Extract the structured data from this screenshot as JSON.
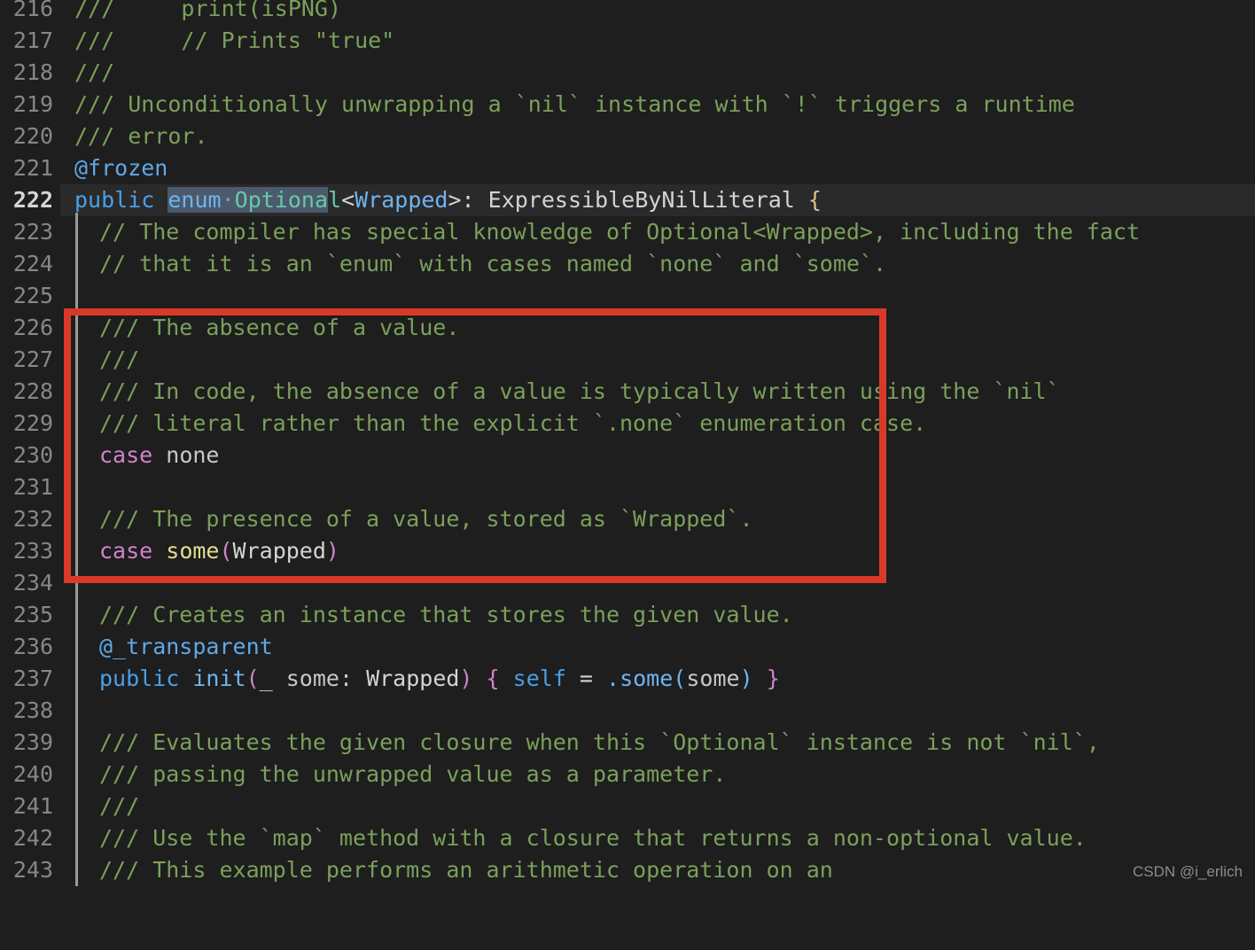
{
  "editor": {
    "background": "#1e1e1e",
    "font_size_px": 25,
    "line_height_px": 36,
    "first_line_number": 216,
    "current_line_number": 222,
    "selection_color": "#4c5a6b",
    "annotation_color": "#d93a27"
  },
  "gutter": {
    "line_numbers": [
      "216",
      "217",
      "218",
      "219",
      "220",
      "221",
      "222",
      "223",
      "224",
      "225",
      "226",
      "227",
      "228",
      "229",
      "230",
      "231",
      "232",
      "233",
      "234",
      "235",
      "236",
      "237",
      "238",
      "239",
      "240",
      "241",
      "242",
      "243"
    ]
  },
  "lines": [
    {
      "n": "216",
      "text": "///     print(isPNG)"
    },
    {
      "n": "217",
      "text": "///     // Prints \"true\""
    },
    {
      "n": "218",
      "text": "///"
    },
    {
      "n": "219",
      "text": "/// Unconditionally unwrapping a `nil` instance with `!` triggers a runtime"
    },
    {
      "n": "220",
      "text": "/// error."
    },
    {
      "n": "221",
      "text": "@frozen"
    },
    {
      "n": "222",
      "text": "public enum Optional<Wrapped>: ExpressibleByNilLiteral {"
    },
    {
      "n": "223",
      "text": "  // The compiler has special knowledge of Optional<Wrapped>, including the fact"
    },
    {
      "n": "224",
      "text": "  // that it is an `enum` with cases named `none` and `some`."
    },
    {
      "n": "225",
      "text": ""
    },
    {
      "n": "226",
      "text": "  /// The absence of a value."
    },
    {
      "n": "227",
      "text": "  ///"
    },
    {
      "n": "228",
      "text": "  /// In code, the absence of a value is typically written using the `nil`"
    },
    {
      "n": "229",
      "text": "  /// literal rather than the explicit `.none` enumeration case."
    },
    {
      "n": "230",
      "text": "  case none"
    },
    {
      "n": "231",
      "text": ""
    },
    {
      "n": "232",
      "text": "  /// The presence of a value, stored as `Wrapped`."
    },
    {
      "n": "233",
      "text": "  case some(Wrapped)"
    },
    {
      "n": "234",
      "text": ""
    },
    {
      "n": "235",
      "text": "  /// Creates an instance that stores the given value."
    },
    {
      "n": "236",
      "text": "  @_transparent"
    },
    {
      "n": "237",
      "text": "  public init(_ some: Wrapped) { self = .some(some) }"
    },
    {
      "n": "238",
      "text": ""
    },
    {
      "n": "239",
      "text": "  /// Evaluates the given closure when this `Optional` instance is not `nil`,"
    },
    {
      "n": "240",
      "text": "  /// passing the unwrapped value as a parameter."
    },
    {
      "n": "241",
      "text": "  ///"
    },
    {
      "n": "242",
      "text": "  /// Use the `map` method with a closure that returns a non-optional value."
    },
    {
      "n": "243",
      "text": "  /// This example performs an arithmetic operation on an"
    }
  ],
  "tokens": {
    "l216_doc": "///     print(isPNG)",
    "l217_doc": "///     // Prints \"true\"",
    "l218_doc": "///",
    "l219_doc": "/// Unconditionally unwrapping a `nil` instance with `!` triggers a runtime",
    "l220_doc": "/// error.",
    "l221_attr": "@frozen",
    "l222_public": "public ",
    "l222_sel_enum": "enum",
    "l222_sel_dot": "·",
    "l222_sel_optiona": "Optiona",
    "l222_l": "l",
    "l222_lt": "<",
    "l222_wrapped": "Wrapped",
    "l222_gt": ">",
    "l222_conform": ": ExpressibleByNilLiteral ",
    "l222_brace": "{",
    "l223_cmt": "// The compiler has special knowledge of Optional<Wrapped>, including the fact",
    "l224_cmt": "// that it is an `enum` with cases named `none` and `some`.",
    "l226_doc": "/// The absence of a value.",
    "l227_doc": "///",
    "l228_doc": "/// In code, the absence of a value is typically written using the `nil`",
    "l229_doc": "/// literal rather than the explicit `.none` enumeration case.",
    "l230_case": "case ",
    "l230_none": "none",
    "l232_doc": "/// The presence of a value, stored as `Wrapped`.",
    "l233_case": "case ",
    "l233_some": "some",
    "l233_lparen": "(",
    "l233_wrapped": "Wrapped",
    "l233_rparen": ")",
    "l235_doc": "/// Creates an instance that stores the given value.",
    "l236_attr": "@_transparent",
    "l237_public": "public ",
    "l237_init": "init",
    "l237_lparen": "(",
    "l237_params": "_ some: ",
    "l237_wrapped": "Wrapped",
    "l237_rparen": ")",
    "l237_space1": " ",
    "l237_lbrace": "{",
    "l237_self": " self",
    "l237_eq": " = ",
    "l237_dotsome": ".some",
    "l237_lparen2": "(",
    "l237_arg": "some",
    "l237_rparen2": ")",
    "l237_space2": " ",
    "l237_rbrace": "}",
    "l239_doc": "/// Evaluates the given closure when this `Optional` instance is not `nil`,",
    "l240_doc": "/// passing the unwrapped value as a parameter.",
    "l241_doc": "///",
    "l242_doc": "/// Use the `map` method with a closure that returns a non-optional value.",
    "l243_doc": "/// This example performs an arithmetic operation on an"
  },
  "annotation": {
    "label": "red-highlight-rectangle",
    "covers_lines": "226-233"
  },
  "watermark": {
    "text": "CSDN @i_erlich"
  }
}
